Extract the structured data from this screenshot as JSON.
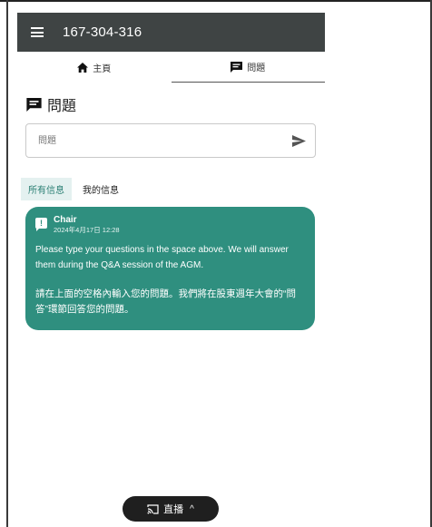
{
  "topbar": {
    "meeting_id": "167-304-316"
  },
  "tabs": [
    {
      "label": "主頁",
      "icon": "home-icon"
    },
    {
      "label": "問題",
      "icon": "chat-icon"
    }
  ],
  "section": {
    "title": "問題"
  },
  "question_input": {
    "placeholder": "問題",
    "value": ""
  },
  "message_tabs": [
    {
      "label": "所有信息",
      "active": true
    },
    {
      "label": "我的信息",
      "active": false
    }
  ],
  "message": {
    "badge": "!",
    "sender": "Chair",
    "timestamp": "2024年4月17日 12:28",
    "body_en": "Please type your questions in the space above.  We will answer them during the Q&A session of the AGM.",
    "body_zh": "請在上面的空格內輸入您的問題。我們將在股東週年大會的“問答”環節回答您的問題。"
  },
  "live_button": {
    "label": "直播",
    "caret": "^"
  },
  "colors": {
    "topbar": "#3f4444",
    "accent": "#2f8f7f",
    "tab_active_bg": "#e4f1f0",
    "pill": "#1f1f1f"
  }
}
